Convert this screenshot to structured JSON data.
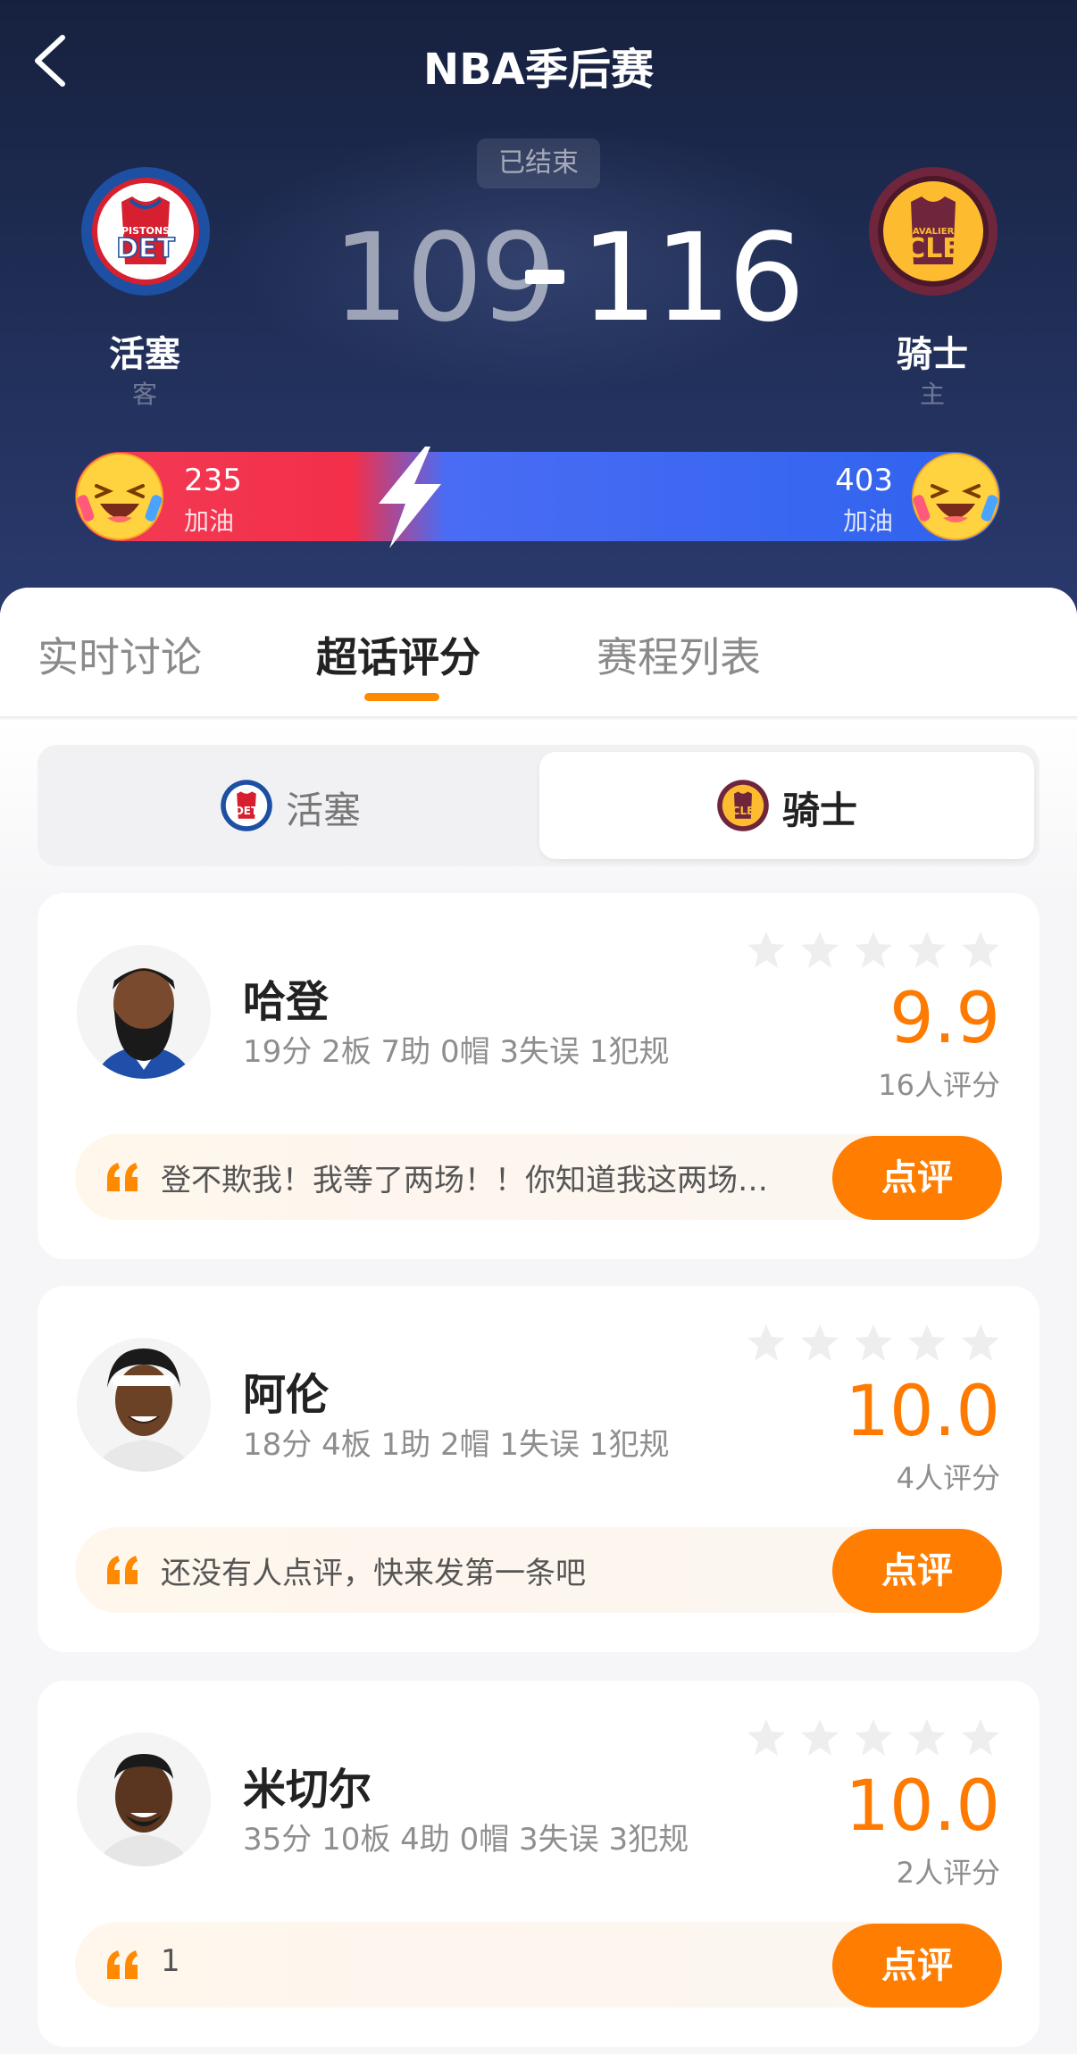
{
  "header": {
    "title": "NBA季后赛",
    "status": "已结束"
  },
  "away_team": {
    "name": "活塞",
    "role": "客",
    "logo_text": "DET",
    "logo_subtext": "PISTONS",
    "score": "109",
    "cheer_count": "235",
    "cheer_label": "加油"
  },
  "home_team": {
    "name": "骑士",
    "role": "主",
    "logo_text": "CLE",
    "logo_subtext": "CAVALIERS",
    "score": "116",
    "cheer_count": "403",
    "cheer_label": "加油"
  },
  "tabs": [
    {
      "label": "实时讨论"
    },
    {
      "label": "超话评分"
    },
    {
      "label": "赛程列表"
    }
  ],
  "team_switch": {
    "away_label": "活塞",
    "home_label": "骑士",
    "selected": "home"
  },
  "players": [
    {
      "name": "哈登",
      "stats": "19分 2板 7助 0帽 3失误 1犯规",
      "rating": "9.9",
      "rating_count": "16人评分",
      "quote": "登不欺我！我等了两场！！你知道我这两场…",
      "button": "点评"
    },
    {
      "name": "阿伦",
      "stats": "18分 4板 1助 2帽 1失误 1犯规",
      "rating": "10.0",
      "rating_count": "4人评分",
      "quote": "还没有人点评，快来发第一条吧",
      "button": "点评"
    },
    {
      "name": "米切尔",
      "stats": "35分 10板 4助 0帽 3失误 3犯规",
      "rating": "10.0",
      "rating_count": "2人评分",
      "quote": "1",
      "button": "点评"
    }
  ],
  "colors": {
    "accent": "#ff7d00",
    "away_primary": "#1d4fa3",
    "away_secondary": "#d6202f",
    "home_primary": "#6f263d",
    "home_secondary": "#fdbb30",
    "cheer_away": "#f33b55",
    "cheer_home": "#2f63ee"
  },
  "icons": {
    "back": "chevron-left-icon",
    "bolt": "lightning-icon",
    "cheer": "laughing-emoji-icon",
    "star": "star-icon",
    "quote": "quote-icon"
  }
}
